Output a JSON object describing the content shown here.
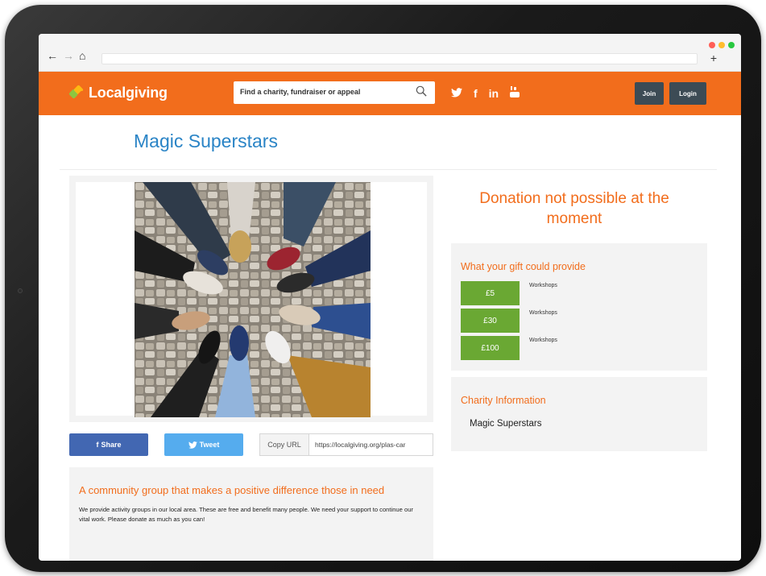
{
  "browser": {
    "back_icon": "arrow-left-icon",
    "forward_icon": "arrow-right-icon",
    "home_icon": "home-icon",
    "new_tab_icon": "plus-icon",
    "window_dot_colors": [
      "#ff5f57",
      "#ffbd2e",
      "#28c840"
    ]
  },
  "header": {
    "logo_text": "Localgiving",
    "logo_colors": [
      "#8dc63f",
      "#fdb913",
      "#f26d1c"
    ],
    "search_placeholder": "Find a charity, fundraiser or appeal",
    "search_icon": "search-icon",
    "social": [
      {
        "name": "twitter-icon",
        "glyph": "🐦"
      },
      {
        "name": "facebook-icon",
        "glyph": "f"
      },
      {
        "name": "linkedin-icon",
        "glyph": "in"
      },
      {
        "name": "youtube-icon",
        "glyph": "You"
      }
    ],
    "join_label": "Join",
    "login_label": "Login",
    "accent": "#f26d1c",
    "button_color": "#3c4b55"
  },
  "page": {
    "title": "Magic Superstars",
    "title_color": "#2a84c6"
  },
  "share": {
    "facebook_label": "Share",
    "facebook_color": "#4267b2",
    "twitter_label": "Tweet",
    "twitter_color": "#55acee",
    "copy_label": "Copy URL",
    "copy_url": "https://localgiving.org/plas-car"
  },
  "description": {
    "title": "A community group that makes a positive difference those in need",
    "text": "We provide activity groups in our local area. These are free and benefit many people. We need your support to continue our vital work. Please donate as much as you can!"
  },
  "donation": {
    "message": "Donation not possible at the moment"
  },
  "gifts": {
    "title": "What your gift could provide",
    "items": [
      {
        "amount": "£5",
        "desc": "Workshops"
      },
      {
        "amount": "£30",
        "desc": "Workshops"
      },
      {
        "amount": "£100",
        "desc": "Workshops"
      }
    ],
    "button_color": "#6aa833"
  },
  "charity_info": {
    "title": "Charity Information",
    "name": "Magic Superstars"
  }
}
